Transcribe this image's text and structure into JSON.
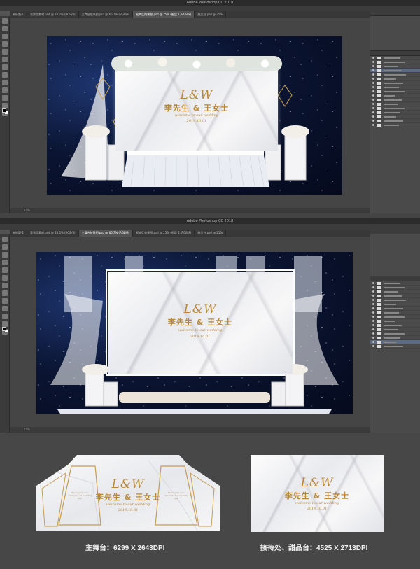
{
  "app": {
    "window_title": "Adobe Photoshop CC 2018",
    "tabs_top": [
      "未标题-1",
      "背景墙素材.psd @ 33.3% (RGB/8)",
      "主舞台效果图.psd @ 66.7% (RGB/8)",
      "迎宾区效果图.psd @ 25% (图层 1, RGB/8)",
      "甜品台.psd @ 25%"
    ],
    "tabs_bottom": [
      "未标题-1",
      "背景墙素材.psd @ 33.3% (RGB/8)",
      "主舞台效果图.psd @ 66.7% (RGB/8)",
      "迎宾区效果图.psd @ 25% (图层 1, RGB/8)",
      "甜品台.psd @ 25%"
    ],
    "status_zoom_top": "25%",
    "status_zoom_bottom": "25%"
  },
  "design": {
    "monogram": "L&W",
    "names": "李先生 & 王女士",
    "tagline": "welcome to our wedding",
    "date": "2019.10.01",
    "side_note_left": "Please join us to celebrate our wedding day",
    "side_note_right": "Please join us to celebrate our wedding day"
  },
  "captions": {
    "main_stage": "主舞台：6299 X 2643DPI",
    "reception": "接待处、甜品台：4525 X 2713DPI"
  },
  "colors": {
    "gold": "#b8883a",
    "night_sky": "#0b1533",
    "ps_panel": "#535353"
  }
}
